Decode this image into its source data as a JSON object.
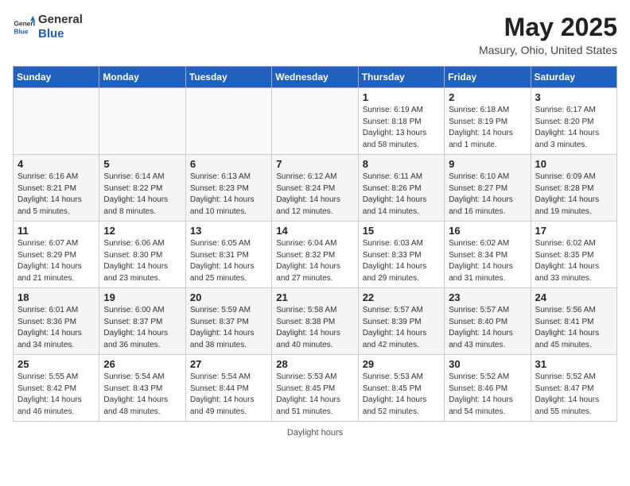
{
  "logo": {
    "general": "General",
    "blue": "Blue"
  },
  "header": {
    "month_year": "May 2025",
    "location": "Masury, Ohio, United States"
  },
  "days_of_week": [
    "Sunday",
    "Monday",
    "Tuesday",
    "Wednesday",
    "Thursday",
    "Friday",
    "Saturday"
  ],
  "footer": {
    "note": "Daylight hours"
  },
  "weeks": [
    [
      {
        "day": "",
        "info": ""
      },
      {
        "day": "",
        "info": ""
      },
      {
        "day": "",
        "info": ""
      },
      {
        "day": "",
        "info": ""
      },
      {
        "day": "1",
        "info": "Sunrise: 6:19 AM\nSunset: 8:18 PM\nDaylight: 13 hours\nand 58 minutes."
      },
      {
        "day": "2",
        "info": "Sunrise: 6:18 AM\nSunset: 8:19 PM\nDaylight: 14 hours\nand 1 minute."
      },
      {
        "day": "3",
        "info": "Sunrise: 6:17 AM\nSunset: 8:20 PM\nDaylight: 14 hours\nand 3 minutes."
      }
    ],
    [
      {
        "day": "4",
        "info": "Sunrise: 6:16 AM\nSunset: 8:21 PM\nDaylight: 14 hours\nand 5 minutes."
      },
      {
        "day": "5",
        "info": "Sunrise: 6:14 AM\nSunset: 8:22 PM\nDaylight: 14 hours\nand 8 minutes."
      },
      {
        "day": "6",
        "info": "Sunrise: 6:13 AM\nSunset: 8:23 PM\nDaylight: 14 hours\nand 10 minutes."
      },
      {
        "day": "7",
        "info": "Sunrise: 6:12 AM\nSunset: 8:24 PM\nDaylight: 14 hours\nand 12 minutes."
      },
      {
        "day": "8",
        "info": "Sunrise: 6:11 AM\nSunset: 8:26 PM\nDaylight: 14 hours\nand 14 minutes."
      },
      {
        "day": "9",
        "info": "Sunrise: 6:10 AM\nSunset: 8:27 PM\nDaylight: 14 hours\nand 16 minutes."
      },
      {
        "day": "10",
        "info": "Sunrise: 6:09 AM\nSunset: 8:28 PM\nDaylight: 14 hours\nand 19 minutes."
      }
    ],
    [
      {
        "day": "11",
        "info": "Sunrise: 6:07 AM\nSunset: 8:29 PM\nDaylight: 14 hours\nand 21 minutes."
      },
      {
        "day": "12",
        "info": "Sunrise: 6:06 AM\nSunset: 8:30 PM\nDaylight: 14 hours\nand 23 minutes."
      },
      {
        "day": "13",
        "info": "Sunrise: 6:05 AM\nSunset: 8:31 PM\nDaylight: 14 hours\nand 25 minutes."
      },
      {
        "day": "14",
        "info": "Sunrise: 6:04 AM\nSunset: 8:32 PM\nDaylight: 14 hours\nand 27 minutes."
      },
      {
        "day": "15",
        "info": "Sunrise: 6:03 AM\nSunset: 8:33 PM\nDaylight: 14 hours\nand 29 minutes."
      },
      {
        "day": "16",
        "info": "Sunrise: 6:02 AM\nSunset: 8:34 PM\nDaylight: 14 hours\nand 31 minutes."
      },
      {
        "day": "17",
        "info": "Sunrise: 6:02 AM\nSunset: 8:35 PM\nDaylight: 14 hours\nand 33 minutes."
      }
    ],
    [
      {
        "day": "18",
        "info": "Sunrise: 6:01 AM\nSunset: 8:36 PM\nDaylight: 14 hours\nand 34 minutes."
      },
      {
        "day": "19",
        "info": "Sunrise: 6:00 AM\nSunset: 8:37 PM\nDaylight: 14 hours\nand 36 minutes."
      },
      {
        "day": "20",
        "info": "Sunrise: 5:59 AM\nSunset: 8:37 PM\nDaylight: 14 hours\nand 38 minutes."
      },
      {
        "day": "21",
        "info": "Sunrise: 5:58 AM\nSunset: 8:38 PM\nDaylight: 14 hours\nand 40 minutes."
      },
      {
        "day": "22",
        "info": "Sunrise: 5:57 AM\nSunset: 8:39 PM\nDaylight: 14 hours\nand 42 minutes."
      },
      {
        "day": "23",
        "info": "Sunrise: 5:57 AM\nSunset: 8:40 PM\nDaylight: 14 hours\nand 43 minutes."
      },
      {
        "day": "24",
        "info": "Sunrise: 5:56 AM\nSunset: 8:41 PM\nDaylight: 14 hours\nand 45 minutes."
      }
    ],
    [
      {
        "day": "25",
        "info": "Sunrise: 5:55 AM\nSunset: 8:42 PM\nDaylight: 14 hours\nand 46 minutes."
      },
      {
        "day": "26",
        "info": "Sunrise: 5:54 AM\nSunset: 8:43 PM\nDaylight: 14 hours\nand 48 minutes."
      },
      {
        "day": "27",
        "info": "Sunrise: 5:54 AM\nSunset: 8:44 PM\nDaylight: 14 hours\nand 49 minutes."
      },
      {
        "day": "28",
        "info": "Sunrise: 5:53 AM\nSunset: 8:45 PM\nDaylight: 14 hours\nand 51 minutes."
      },
      {
        "day": "29",
        "info": "Sunrise: 5:53 AM\nSunset: 8:45 PM\nDaylight: 14 hours\nand 52 minutes."
      },
      {
        "day": "30",
        "info": "Sunrise: 5:52 AM\nSunset: 8:46 PM\nDaylight: 14 hours\nand 54 minutes."
      },
      {
        "day": "31",
        "info": "Sunrise: 5:52 AM\nSunset: 8:47 PM\nDaylight: 14 hours\nand 55 minutes."
      }
    ]
  ]
}
